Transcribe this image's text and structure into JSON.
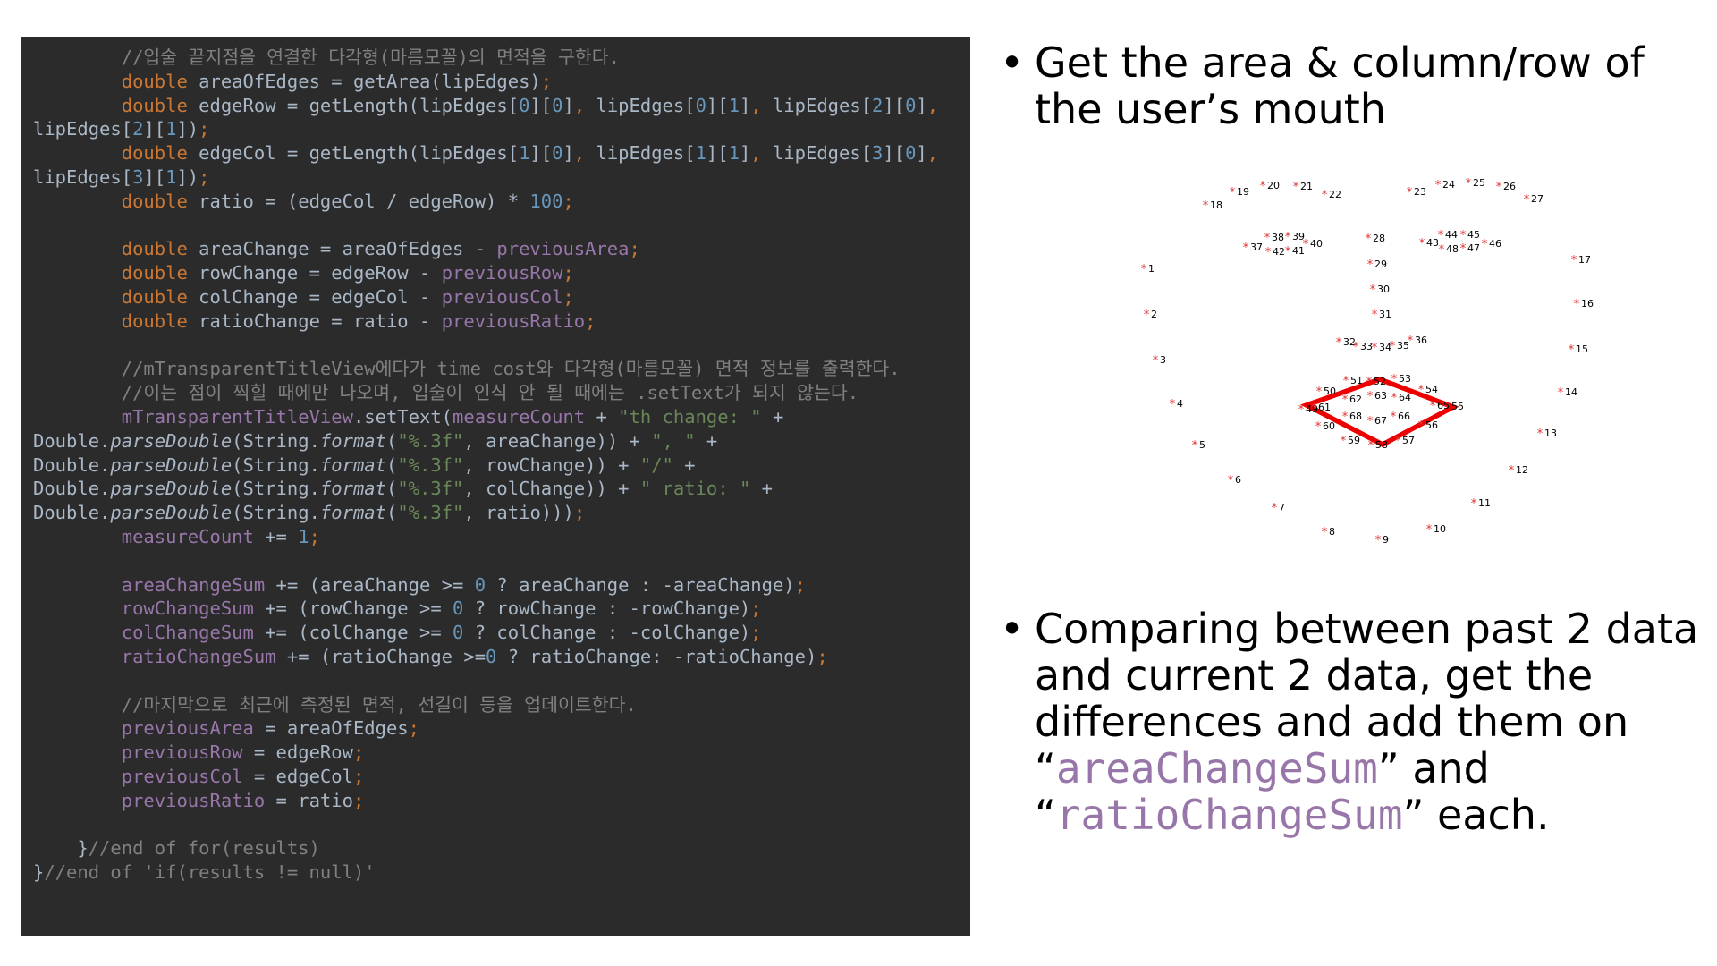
{
  "code": {
    "lines": [
      [
        {
          "t": "        "
        },
        {
          "t": "//입술 끝지점을 연결한 다각형(마름모꼴)의 면적을 구한다.",
          "c": "cm"
        }
      ],
      [
        {
          "t": "        "
        },
        {
          "t": "double",
          "c": "kw"
        },
        {
          "t": " areaOfEdges = getArea(lipEdges)"
        },
        {
          "t": ";",
          "c": "kw"
        }
      ],
      [
        {
          "t": "        "
        },
        {
          "t": "double",
          "c": "kw"
        },
        {
          "t": " edgeRow = getLength(lipEdges["
        },
        {
          "t": "0",
          "c": "num"
        },
        {
          "t": "]["
        },
        {
          "t": "0",
          "c": "num"
        },
        {
          "t": "]"
        },
        {
          "t": ",",
          "c": "kw"
        },
        {
          "t": " lipEdges["
        },
        {
          "t": "0",
          "c": "num"
        },
        {
          "t": "]["
        },
        {
          "t": "1",
          "c": "num"
        },
        {
          "t": "]"
        },
        {
          "t": ",",
          "c": "kw"
        },
        {
          "t": " lipEdges["
        },
        {
          "t": "2",
          "c": "num"
        },
        {
          "t": "]["
        },
        {
          "t": "0",
          "c": "num"
        },
        {
          "t": "]"
        },
        {
          "t": ",",
          "c": "kw"
        }
      ],
      [
        {
          "t": "lipEdges["
        },
        {
          "t": "2",
          "c": "num"
        },
        {
          "t": "]["
        },
        {
          "t": "1",
          "c": "num"
        },
        {
          "t": "])"
        },
        {
          "t": ";",
          "c": "kw"
        }
      ],
      [
        {
          "t": "        "
        },
        {
          "t": "double",
          "c": "kw"
        },
        {
          "t": " edgeCol = getLength(lipEdges["
        },
        {
          "t": "1",
          "c": "num"
        },
        {
          "t": "]["
        },
        {
          "t": "0",
          "c": "num"
        },
        {
          "t": "]"
        },
        {
          "t": ",",
          "c": "kw"
        },
        {
          "t": " lipEdges["
        },
        {
          "t": "1",
          "c": "num"
        },
        {
          "t": "]["
        },
        {
          "t": "1",
          "c": "num"
        },
        {
          "t": "]"
        },
        {
          "t": ",",
          "c": "kw"
        },
        {
          "t": " lipEdges["
        },
        {
          "t": "3",
          "c": "num"
        },
        {
          "t": "]["
        },
        {
          "t": "0",
          "c": "num"
        },
        {
          "t": "]"
        },
        {
          "t": ",",
          "c": "kw"
        }
      ],
      [
        {
          "t": "lipEdges["
        },
        {
          "t": "3",
          "c": "num"
        },
        {
          "t": "]["
        },
        {
          "t": "1",
          "c": "num"
        },
        {
          "t": "])"
        },
        {
          "t": ";",
          "c": "kw"
        }
      ],
      [
        {
          "t": "        "
        },
        {
          "t": "double",
          "c": "kw"
        },
        {
          "t": " ratio = (edgeCol / edgeRow) * "
        },
        {
          "t": "100",
          "c": "num"
        },
        {
          "t": ";",
          "c": "kw"
        }
      ],
      [],
      [
        {
          "t": "        "
        },
        {
          "t": "double",
          "c": "kw"
        },
        {
          "t": " areaChange = areaOfEdges - "
        },
        {
          "t": "previousArea",
          "c": "fld"
        },
        {
          "t": ";",
          "c": "kw"
        }
      ],
      [
        {
          "t": "        "
        },
        {
          "t": "double",
          "c": "kw"
        },
        {
          "t": " rowChange = edgeRow - "
        },
        {
          "t": "previousRow",
          "c": "fld"
        },
        {
          "t": ";",
          "c": "kw"
        }
      ],
      [
        {
          "t": "        "
        },
        {
          "t": "double",
          "c": "kw"
        },
        {
          "t": " colChange = edgeCol - "
        },
        {
          "t": "previousCol",
          "c": "fld"
        },
        {
          "t": ";",
          "c": "kw"
        }
      ],
      [
        {
          "t": "        "
        },
        {
          "t": "double",
          "c": "kw"
        },
        {
          "t": " ratioChange = ratio - "
        },
        {
          "t": "previousRatio",
          "c": "fld"
        },
        {
          "t": ";",
          "c": "kw"
        }
      ],
      [],
      [
        {
          "t": "        "
        },
        {
          "t": "//mTransparentTitleView에다가 time cost와 다각형(마름모꼴) 면적 정보를 출력한다.",
          "c": "cm"
        }
      ],
      [
        {
          "t": "        "
        },
        {
          "t": "//이는 점이 찍힐 때에만 나오며, 입술이 인식 안 될 때에는 .setText가 되지 않는다.",
          "c": "cm"
        }
      ],
      [
        {
          "t": "        "
        },
        {
          "t": "mTransparentTitleView",
          "c": "fld"
        },
        {
          "t": ".setText("
        },
        {
          "t": "measureCount",
          "c": "fld"
        },
        {
          "t": " + "
        },
        {
          "t": "\"th change: \"",
          "c": "str"
        },
        {
          "t": " +"
        }
      ],
      [
        {
          "t": "Double."
        },
        {
          "t": "parseDouble",
          "c": "it"
        },
        {
          "t": "(String."
        },
        {
          "t": "format",
          "c": "it"
        },
        {
          "t": "("
        },
        {
          "t": "\"%.3f\"",
          "c": "str"
        },
        {
          "t": ","
        },
        {
          "t": " areaChange)) + "
        },
        {
          "t": "\", \"",
          "c": "str"
        },
        {
          "t": " +"
        }
      ],
      [
        {
          "t": "Double."
        },
        {
          "t": "parseDouble",
          "c": "it"
        },
        {
          "t": "(String."
        },
        {
          "t": "format",
          "c": "it"
        },
        {
          "t": "("
        },
        {
          "t": "\"%.3f\"",
          "c": "str"
        },
        {
          "t": ","
        },
        {
          "t": " rowChange)) + "
        },
        {
          "t": "\"/\"",
          "c": "str"
        },
        {
          "t": " +"
        }
      ],
      [
        {
          "t": "Double."
        },
        {
          "t": "parseDouble",
          "c": "it"
        },
        {
          "t": "(String."
        },
        {
          "t": "format",
          "c": "it"
        },
        {
          "t": "("
        },
        {
          "t": "\"%.3f\"",
          "c": "str"
        },
        {
          "t": ","
        },
        {
          "t": " colChange)) + "
        },
        {
          "t": "\" ratio: \"",
          "c": "str"
        },
        {
          "t": " +"
        }
      ],
      [
        {
          "t": "Double."
        },
        {
          "t": "parseDouble",
          "c": "it"
        },
        {
          "t": "(String."
        },
        {
          "t": "format",
          "c": "it"
        },
        {
          "t": "("
        },
        {
          "t": "\"%.3f\"",
          "c": "str"
        },
        {
          "t": ","
        },
        {
          "t": " ratio)))"
        },
        {
          "t": ";",
          "c": "kw"
        }
      ],
      [
        {
          "t": "        "
        },
        {
          "t": "measureCount",
          "c": "fld"
        },
        {
          "t": " += "
        },
        {
          "t": "1",
          "c": "num"
        },
        {
          "t": ";",
          "c": "kw"
        }
      ],
      [],
      [
        {
          "t": "        "
        },
        {
          "t": "areaChangeSum",
          "c": "fld"
        },
        {
          "t": " += (areaChange >= "
        },
        {
          "t": "0",
          "c": "num"
        },
        {
          "t": " ? areaChange : -areaChange)"
        },
        {
          "t": ";",
          "c": "kw"
        }
      ],
      [
        {
          "t": "        "
        },
        {
          "t": "rowChangeSum",
          "c": "fld"
        },
        {
          "t": " += (rowChange >= "
        },
        {
          "t": "0",
          "c": "num"
        },
        {
          "t": " ? rowChange : -rowChange)"
        },
        {
          "t": ";",
          "c": "kw"
        }
      ],
      [
        {
          "t": "        "
        },
        {
          "t": "colChangeSum",
          "c": "fld"
        },
        {
          "t": " += (colChange >= "
        },
        {
          "t": "0",
          "c": "num"
        },
        {
          "t": " ? colChange : -colChange)"
        },
        {
          "t": ";",
          "c": "kw"
        }
      ],
      [
        {
          "t": "        "
        },
        {
          "t": "ratioChangeSum",
          "c": "fld"
        },
        {
          "t": " += (ratioChange >="
        },
        {
          "t": "0",
          "c": "num"
        },
        {
          "t": " ? ratioChange: -ratioChange)"
        },
        {
          "t": ";",
          "c": "kw"
        }
      ],
      [],
      [
        {
          "t": "        "
        },
        {
          "t": "//마지막으로 최근에 측정된 면적, 선길이 등을 업데이트한다.",
          "c": "cm"
        }
      ],
      [
        {
          "t": "        "
        },
        {
          "t": "previousArea",
          "c": "fld"
        },
        {
          "t": " = areaOfEdges"
        },
        {
          "t": ";",
          "c": "kw"
        }
      ],
      [
        {
          "t": "        "
        },
        {
          "t": "previousRow",
          "c": "fld"
        },
        {
          "t": " = edgeRow"
        },
        {
          "t": ";",
          "c": "kw"
        }
      ],
      [
        {
          "t": "        "
        },
        {
          "t": "previousCol",
          "c": "fld"
        },
        {
          "t": " = edgeCol"
        },
        {
          "t": ";",
          "c": "kw"
        }
      ],
      [
        {
          "t": "        "
        },
        {
          "t": "previousRatio",
          "c": "fld"
        },
        {
          "t": " = ratio"
        },
        {
          "t": ";",
          "c": "kw"
        }
      ],
      [],
      [
        {
          "t": "    }"
        },
        {
          "t": "//end of for(results)",
          "c": "cm"
        }
      ],
      [
        {
          "t": "}"
        },
        {
          "t": "//end of 'if(results != null)'",
          "c": "cm"
        }
      ]
    ]
  },
  "bullets": {
    "dot": "•",
    "first": {
      "line1": "Get the area & column/row of",
      "line2": "the user’s mouth"
    },
    "second": {
      "line1": "Comparing between past 2 data",
      "line2": "and current 2 data, get the",
      "line3": "differences and add them on",
      "open_quote": "“",
      "term1": "areaChangeSum",
      "after_term1": "” and",
      "term2": "ratioChangeSum",
      "after_term2": "” each."
    }
  },
  "landmarks": [
    {
      "n": "1"
    },
    {
      "n": "2"
    },
    {
      "n": "3"
    },
    {
      "n": "4"
    },
    {
      "n": "5"
    },
    {
      "n": "6"
    },
    {
      "n": "7"
    },
    {
      "n": "8"
    },
    {
      "n": "9"
    },
    {
      "n": "10"
    },
    {
      "n": "11"
    },
    {
      "n": "12"
    },
    {
      "n": "13"
    },
    {
      "n": "14"
    },
    {
      "n": "15"
    },
    {
      "n": "16"
    },
    {
      "n": "17"
    },
    {
      "n": "18"
    },
    {
      "n": "19"
    },
    {
      "n": "20"
    },
    {
      "n": "21"
    },
    {
      "n": "22"
    },
    {
      "n": "23"
    },
    {
      "n": "24"
    },
    {
      "n": "25"
    },
    {
      "n": "26"
    },
    {
      "n": "27"
    },
    {
      "n": "28"
    },
    {
      "n": "29"
    },
    {
      "n": "30"
    },
    {
      "n": "31"
    },
    {
      "n": "32"
    },
    {
      "n": "33"
    },
    {
      "n": "34"
    },
    {
      "n": "35"
    },
    {
      "n": "36"
    },
    {
      "n": "37"
    },
    {
      "n": "38"
    },
    {
      "n": "39"
    },
    {
      "n": "40"
    },
    {
      "n": "41"
    },
    {
      "n": "42"
    },
    {
      "n": "43"
    },
    {
      "n": "44"
    },
    {
      "n": "45"
    },
    {
      "n": "46"
    },
    {
      "n": "47"
    },
    {
      "n": "48"
    },
    {
      "n": "49"
    },
    {
      "n": "50"
    },
    {
      "n": "51"
    },
    {
      "n": "52"
    },
    {
      "n": "53"
    },
    {
      "n": "54"
    },
    {
      "n": "55"
    },
    {
      "n": "56"
    },
    {
      "n": "57"
    },
    {
      "n": "58"
    },
    {
      "n": "59"
    },
    {
      "n": "60"
    },
    {
      "n": "61"
    },
    {
      "n": "62"
    },
    {
      "n": "63"
    },
    {
      "n": "64"
    },
    {
      "n": "65"
    },
    {
      "n": "66"
    },
    {
      "n": "67"
    },
    {
      "n": "68"
    }
  ],
  "colors": {
    "code_bg": "#2b2b2b",
    "keyword": "#cc7832",
    "comment": "#808080",
    "number": "#6897bb",
    "string": "#6a8759",
    "field": "#9876aa",
    "mouth_outline": "#ee0000",
    "landmark_dot": "#e03030"
  }
}
